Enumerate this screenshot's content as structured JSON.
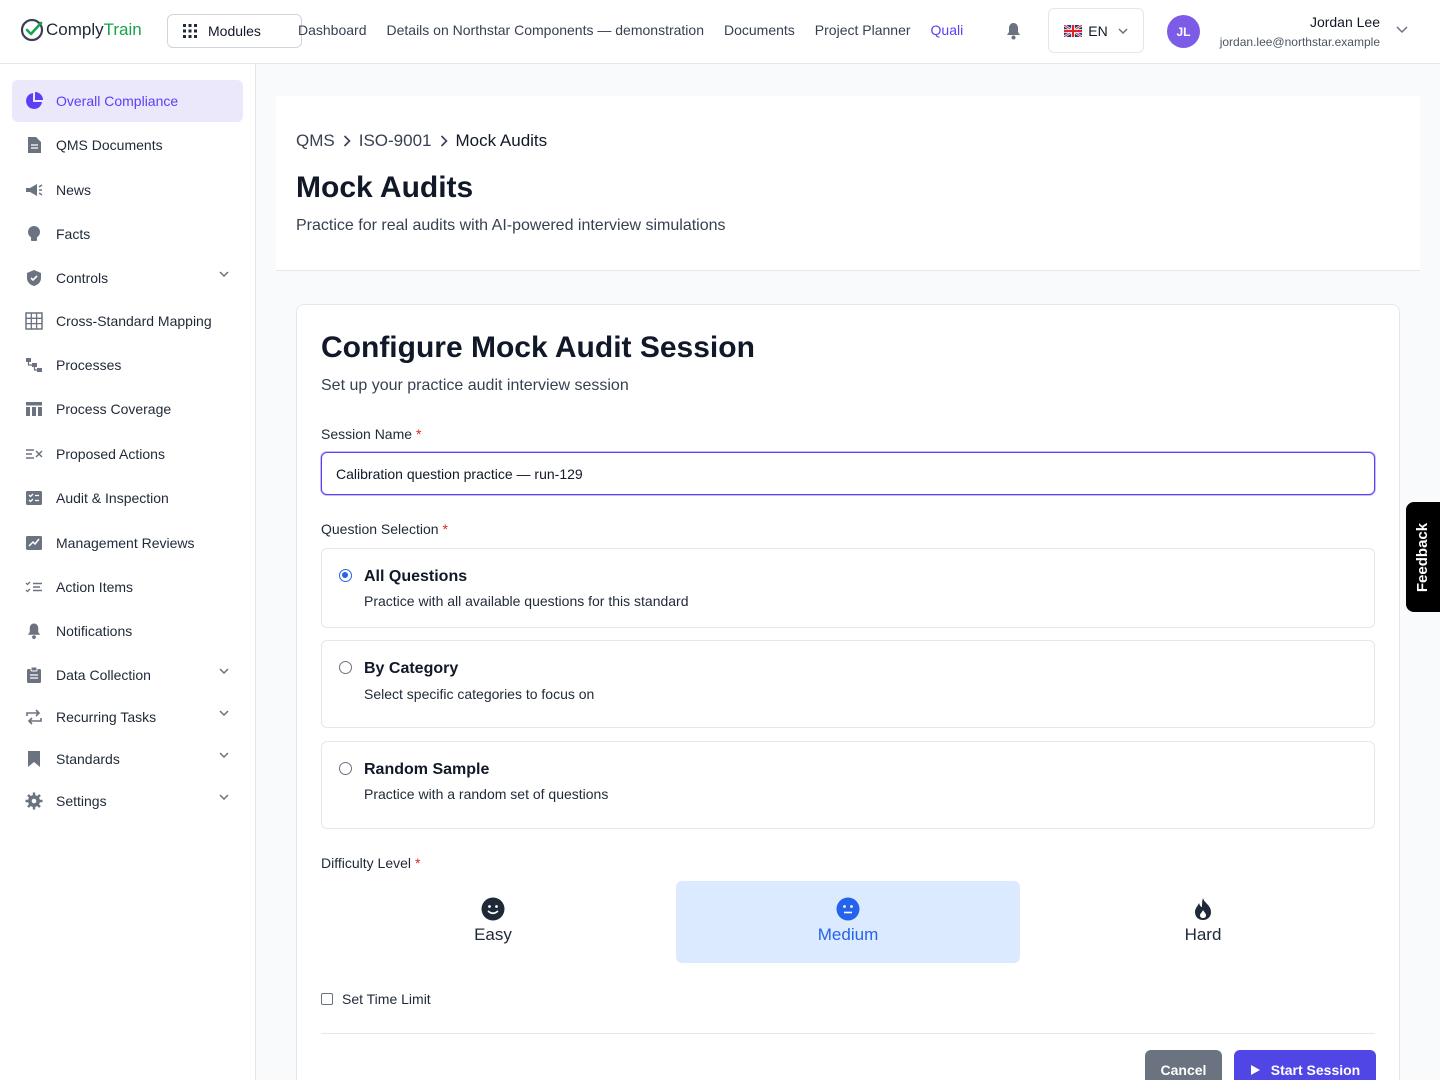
{
  "app": {
    "logo_main": "Comply",
    "logo_accent": "Train",
    "modules_label": "Modules",
    "nav": [
      "Dashboard",
      "Details on Northstar Components — demonstration",
      "Documents",
      "Project Planner",
      "Quali"
    ],
    "language": "EN",
    "user": {
      "initials": "JL",
      "name": "Jordan Lee",
      "email": "jordan.lee@northstar.example"
    }
  },
  "sidebar": {
    "items": [
      {
        "label": "Overall Compliance",
        "icon": "pie-chart-icon",
        "active": true
      },
      {
        "label": "QMS Documents",
        "icon": "document-icon"
      },
      {
        "label": "News",
        "icon": "megaphone-icon"
      },
      {
        "label": "Facts",
        "icon": "lightbulb-icon"
      },
      {
        "label": "Controls",
        "icon": "shield-check-icon",
        "expandable": true
      },
      {
        "label": "Cross-Standard Mapping",
        "icon": "table-grid-icon"
      },
      {
        "label": "Processes",
        "icon": "flow-icon"
      },
      {
        "label": "Process Coverage",
        "icon": "columns-icon"
      },
      {
        "label": "Proposed Actions",
        "icon": "list-x-icon"
      },
      {
        "label": "Audit & Inspection",
        "icon": "checklist-box-icon"
      },
      {
        "label": "Management Reviews",
        "icon": "chart-box-icon"
      },
      {
        "label": "Action Items",
        "icon": "list-check-icon"
      },
      {
        "label": "Notifications",
        "icon": "bell-icon"
      },
      {
        "label": "Data Collection",
        "icon": "clipboard-icon",
        "expandable": true
      },
      {
        "label": "Recurring Tasks",
        "icon": "repeat-icon",
        "expandable": true
      },
      {
        "label": "Standards",
        "icon": "bookmark-icon",
        "expandable": true
      },
      {
        "label": "Settings",
        "icon": "gear-icon",
        "expandable": true
      }
    ]
  },
  "header": {
    "breadcrumb": [
      "QMS",
      "ISO-9001",
      "Mock Audits"
    ],
    "title": "Mock Audits",
    "subtitle": "Practice for real audits with AI-powered interview simulations"
  },
  "form": {
    "title": "Configure Mock Audit Session",
    "subtitle": "Set up your practice audit interview session",
    "session_label": "Session Name",
    "session_value": "Calibration question practice — run-129",
    "question_label": "Question Selection",
    "options": [
      {
        "title": "All Questions",
        "desc": "Practice with all available questions for this standard",
        "selected": true
      },
      {
        "title": "By Category",
        "desc": "Select specific categories to focus on",
        "selected": false
      },
      {
        "title": "Random Sample",
        "desc": "Practice with a random set of questions",
        "selected": false
      }
    ],
    "difficulty_label": "Difficulty Level",
    "difficulty": [
      {
        "label": "Easy",
        "icon": "smile-face-icon"
      },
      {
        "label": "Medium",
        "icon": "neutral-face-icon",
        "selected": true
      },
      {
        "label": "Hard",
        "icon": "fire-icon"
      }
    ],
    "time_limit_label": "Set Time Limit",
    "cancel_label": "Cancel",
    "start_label": "Start Session"
  },
  "feedback_label": "Feedback",
  "colors": {
    "accent": "#5b3ff5",
    "primary_button": "#4f46e5",
    "selected_blue": "#2563eb",
    "selected_bg": "#dbeafe"
  }
}
